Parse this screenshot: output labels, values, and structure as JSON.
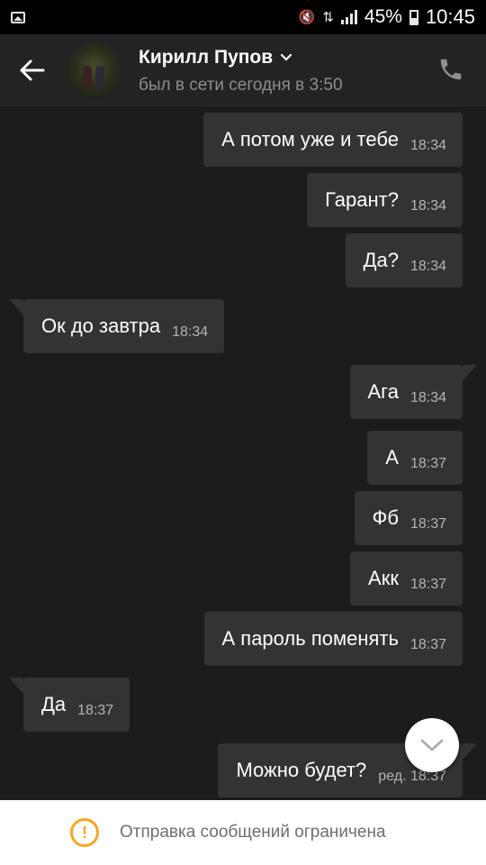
{
  "status_bar": {
    "battery_percent": "45%",
    "time": "10:45"
  },
  "header": {
    "contact_name": "Кирилл Пупов",
    "last_seen": "был в сети сегодня в 3:50"
  },
  "messages": [
    {
      "side": "out",
      "text": "А потом уже и тебе",
      "time": "18:34",
      "tail": false
    },
    {
      "side": "out",
      "text": "Гарант?",
      "time": "18:34",
      "tail": false
    },
    {
      "side": "out",
      "text": "Да?",
      "time": "18:34",
      "tail": false
    },
    {
      "side": "in",
      "text": "Ок до завтра",
      "time": "18:34",
      "tail": true
    },
    {
      "side": "out",
      "text": "Ага",
      "time": "18:34",
      "tail": true
    },
    {
      "side": "out",
      "text": "А",
      "time": "18:37",
      "tail": false
    },
    {
      "side": "out",
      "text": "Фб",
      "time": "18:37",
      "tail": false
    },
    {
      "side": "out",
      "text": "Акк",
      "time": "18:37",
      "tail": false
    },
    {
      "side": "out",
      "text": "А пароль поменять",
      "time": "18:37",
      "tail": false
    },
    {
      "side": "in",
      "text": "Да",
      "time": "18:37",
      "tail": true
    },
    {
      "side": "out",
      "text": "Можно будет?",
      "time": "ред. 18:37",
      "tail": true
    }
  ],
  "footer": {
    "notice": "Отправка сообщений ограничена"
  },
  "colors": {
    "background": "#1c1c1e",
    "bubble": "#333335",
    "warning": "#f5a623"
  },
  "icons": {
    "back": "arrow-left-icon",
    "dropdown": "chevron-down-icon",
    "call": "phone-icon",
    "scroll": "chevron-down-icon",
    "warning": "exclamation-circle-icon"
  }
}
